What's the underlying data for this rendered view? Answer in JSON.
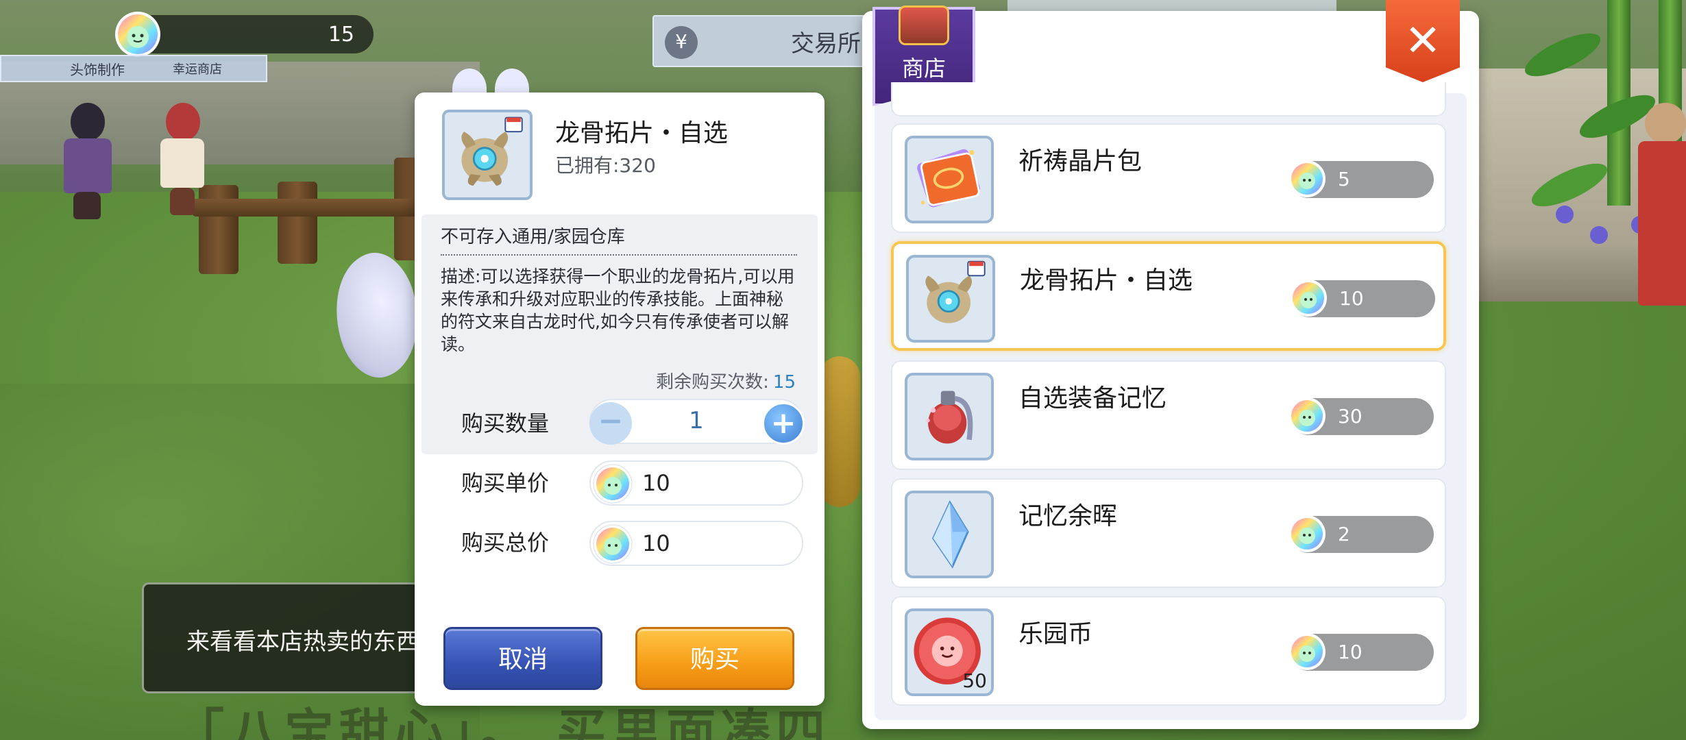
{
  "hud": {
    "currency_icon": "rainbow-coin-icon",
    "currency_amount": "15",
    "sign_headwear": "头饰制作",
    "sign_lucky_shop": "幸运商店",
    "sign_trade": "交易所",
    "npc_dialog": "来看看本店热卖的东西"
  },
  "detail": {
    "item_name": "龙骨拓片・自选",
    "owned_label": "已拥有:320",
    "restriction": "不可存入通用/家园仓库",
    "description": "描述:可以选择获得一个职业的龙骨拓片,可以用来传承和升级对应职业的传承技能。上面神秘的符文来自古龙时代,如今只有传承使者可以解读。",
    "remaining_label": "剩余购买次数:",
    "remaining_value": "15",
    "qty_label": "购买数量",
    "qty_value": "1",
    "unit_price_label": "购买单价",
    "unit_price_value": "10",
    "total_price_label": "购买总价",
    "total_price_value": "10",
    "cancel_label": "取消",
    "buy_label": "购买"
  },
  "shop": {
    "title": "商店",
    "close_glyph": "✕",
    "items": [
      {
        "name": "祈祷晶片包",
        "price": "5",
        "icon": "card-pack-icon",
        "badge": ""
      },
      {
        "name": "龙骨拓片・自选",
        "price": "10",
        "icon": "dragon-bone-icon",
        "badge": ""
      },
      {
        "name": "自选装备记忆",
        "price": "30",
        "icon": "memory-potion-icon",
        "badge": ""
      },
      {
        "name": "记忆余晖",
        "price": "2",
        "icon": "crystal-icon",
        "badge": ""
      },
      {
        "name": "乐园币",
        "price": "10",
        "icon": "paradise-coin-icon",
        "badge": "50"
      }
    ]
  },
  "colors": {
    "accent_blue": "#3653b4",
    "accent_orange": "#f79d17",
    "selected_border": "#f6c650",
    "close_red": "#d8401b"
  }
}
